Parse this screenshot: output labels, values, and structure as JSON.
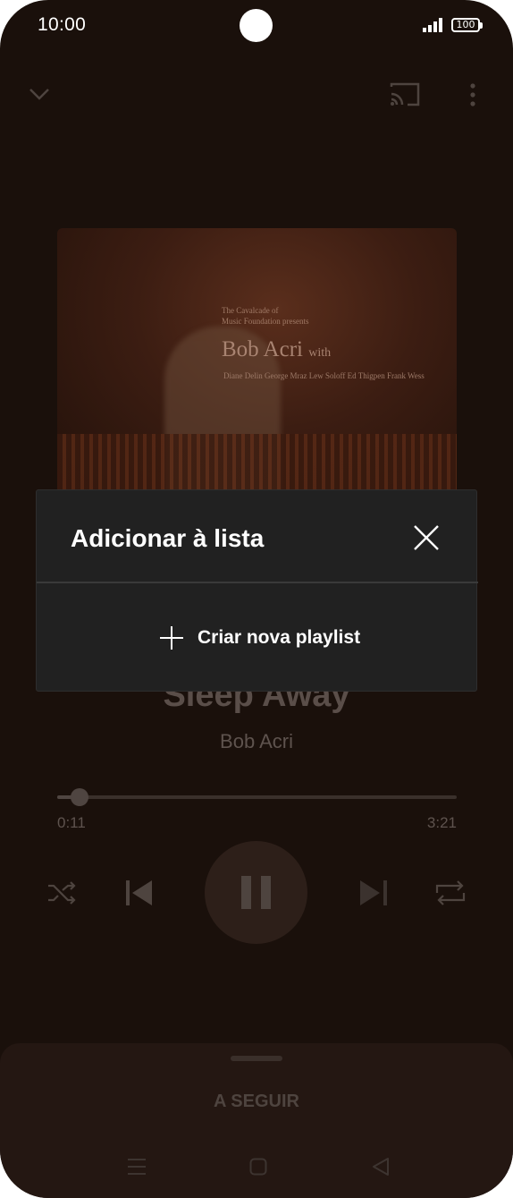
{
  "status_bar": {
    "time": "10:00",
    "battery": "100"
  },
  "top_bar": {
    "icons": [
      "chevron-down-icon",
      "cast-icon",
      "more-vert-icon"
    ]
  },
  "album_art": {
    "header_line1": "The Cavalcade of",
    "header_line2": "Music Foundation presents",
    "artist_script": "Bob Acri",
    "with_text": "with",
    "credits": "Diane Delin  George Mraz  Lew Soloff  Ed Thigpen  Frank Wess"
  },
  "track": {
    "title": "Sleep Away",
    "artist": "Bob Acri"
  },
  "progress": {
    "elapsed": "0:11",
    "duration": "3:21",
    "fraction": 0.055
  },
  "controls": {
    "icons": [
      "shuffle-icon",
      "previous-icon",
      "pause-icon",
      "next-icon",
      "repeat-icon"
    ]
  },
  "up_next": {
    "label": "A SEGUIR"
  },
  "nav_bar": {
    "icons": [
      "recent-apps-icon",
      "home-icon",
      "back-icon"
    ]
  },
  "dialog": {
    "title": "Adicionar à lista",
    "create_label": "Criar nova playlist"
  }
}
